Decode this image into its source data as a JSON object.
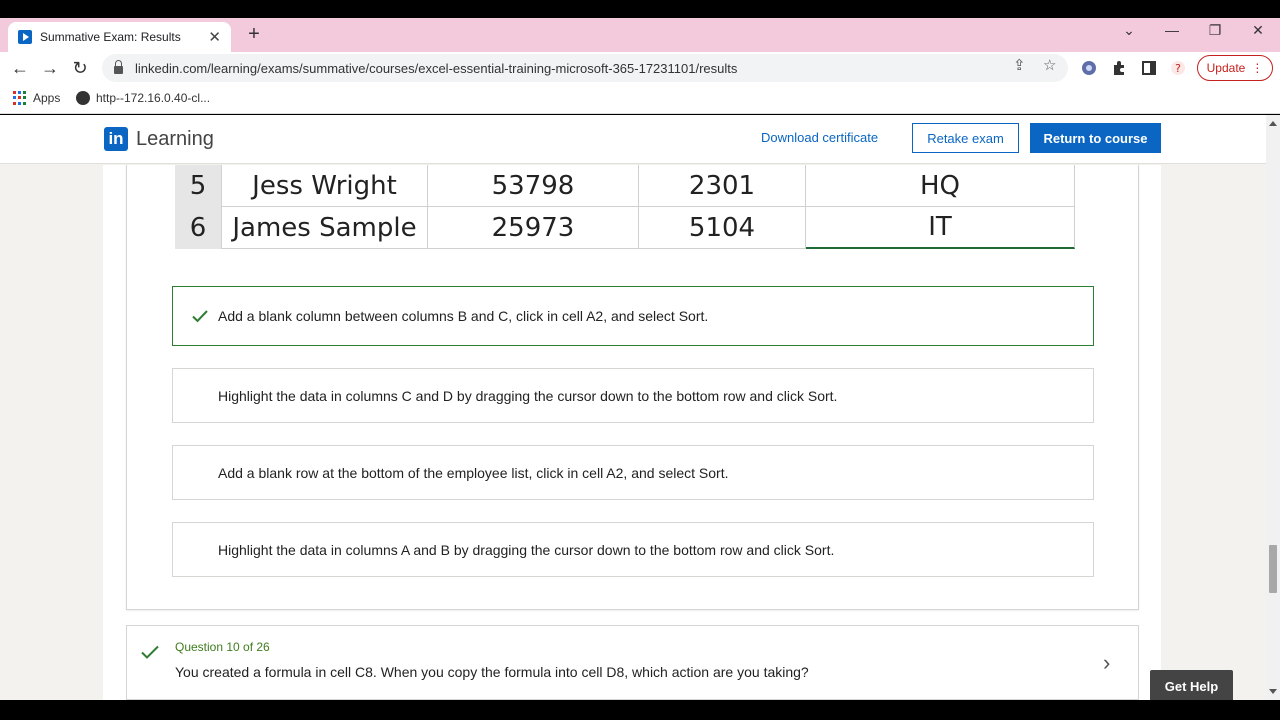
{
  "browser": {
    "tab_title": "Summative Exam: Results",
    "url": "linkedin.com/learning/exams/summative/courses/excel-essential-training-microsoft-365-17231101/results",
    "update_label": "Update",
    "bookmarks": [
      {
        "label": "Apps"
      },
      {
        "label": "http--172.16.0.40-cl..."
      }
    ]
  },
  "header": {
    "logo_text": "Learning",
    "logo_mark": "in",
    "download_label": "Download certificate",
    "retake_label": "Retake exam",
    "return_label": "Return to course"
  },
  "sheet": {
    "rows": [
      {
        "num": "5",
        "name": "Jess Wright",
        "c": "53798",
        "d": "2301",
        "e": "HQ"
      },
      {
        "num": "6",
        "name": "James Sample",
        "c": "25973",
        "d": "5104",
        "e": "IT"
      }
    ]
  },
  "answers": [
    {
      "text": "Add a blank column between columns B and C, click in cell A2, and select Sort.",
      "correct": true
    },
    {
      "text": "Highlight the data in columns C and D by dragging the cursor down to the bottom row and click Sort.",
      "correct": false
    },
    {
      "text": "Add a blank row at the bottom of the employee list, click in cell A2, and select Sort.",
      "correct": false
    },
    {
      "text": "Highlight the data in columns A and B by dragging the cursor down to the bottom row and click Sort.",
      "correct": false
    }
  ],
  "next_question": {
    "number": "Question 10 of 26",
    "text": "You created a formula in cell C8. When you copy the formula into cell D8, which action are you taking?"
  },
  "get_help_label": "Get Help",
  "colors": {
    "brand": "#0a66c2",
    "correct": "#2e7d32"
  }
}
